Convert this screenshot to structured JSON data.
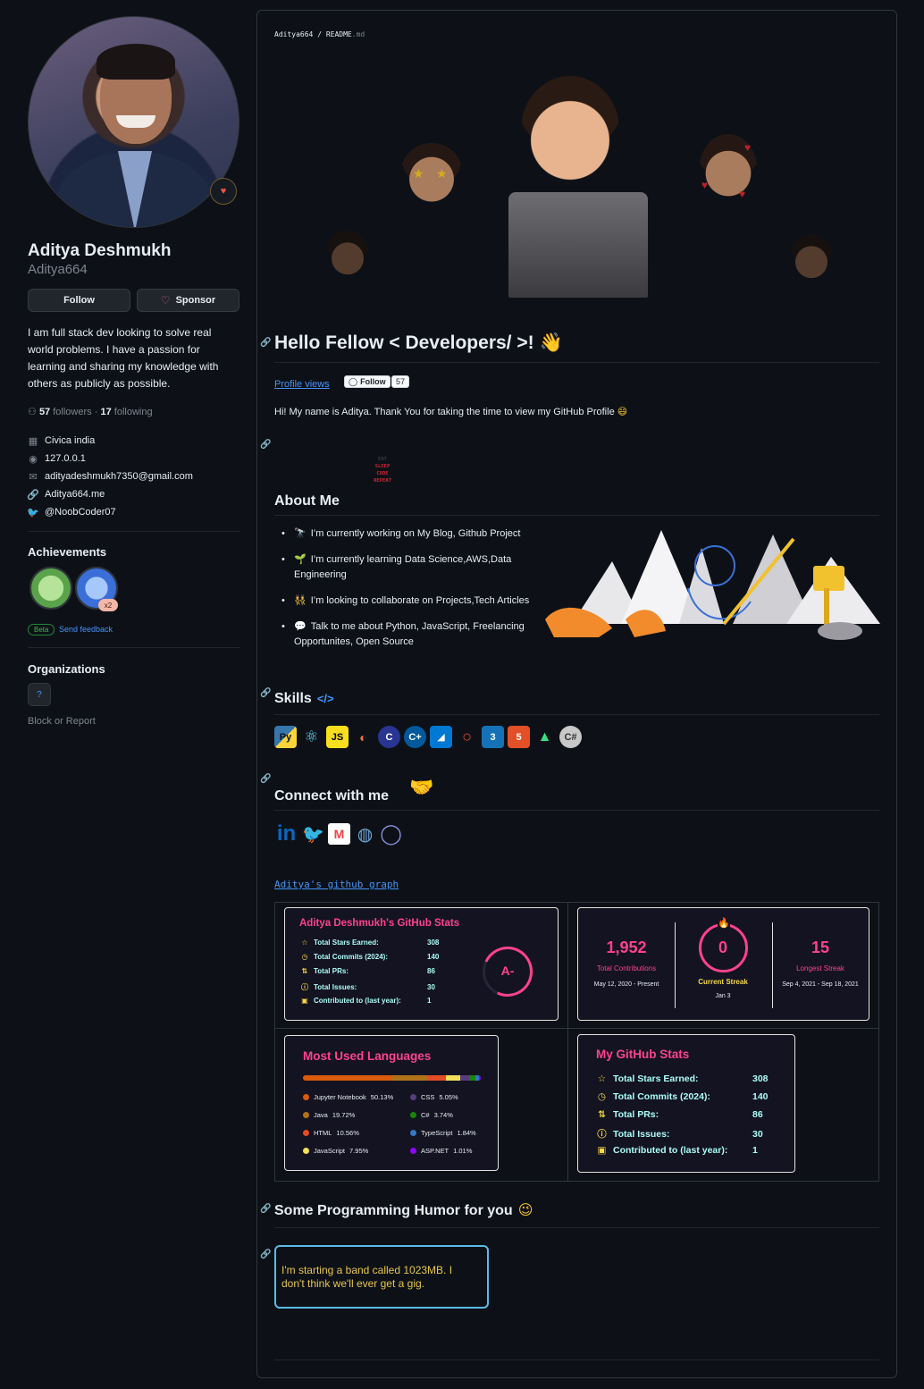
{
  "profile": {
    "name": "Aditya Deshmukh",
    "login": "Aditya664",
    "follow_label": "Follow",
    "sponsor_label": "Sponsor",
    "bio": "I am full stack dev looking to solve real world problems. I have a passion for learning and sharing my knowledge with others as publicly as possible.",
    "followers_count": "57",
    "followers_label": "followers",
    "following_count": "17",
    "following_label": "following",
    "separator": "·",
    "company": "Civica india",
    "location": "127.0.0.1",
    "email": "adityadeshmukh7350@gmail.com",
    "website": "Aditya664.me",
    "twitter": "@NoobCoder07"
  },
  "achievements": {
    "title": "Achievements",
    "multiplier": "x2",
    "beta_label": "Beta",
    "feedback_label": "Send feedback"
  },
  "organizations": {
    "title": "Organizations"
  },
  "block_report": "Block or Report",
  "readme": {
    "owner": "Aditya664",
    "sep": "/",
    "file": "README",
    "ext": ".md",
    "hello_title": "Hello Fellow < Developers/ >!",
    "hello_emoji": "👋",
    "profile_views_alt": "Profile views",
    "follow_badge": "Follow",
    "follow_badge_count": "57",
    "intro": "Hi! My name is Aditya. Thank You for taking the time to view my GitHub Profile",
    "intro_emoji": "😄",
    "sleep_code": [
      "EAT",
      "SLEEP",
      "CODE",
      "REPEAT"
    ],
    "about_title": "About Me",
    "about_items": [
      {
        "emoji": "🔭",
        "text": "I’m currently working on My Blog, Github Project"
      },
      {
        "emoji": "🌱",
        "text": "I’m currently learning Data Science,AWS,Data Engineering"
      },
      {
        "emoji": "👯",
        "text": "I’m looking to collaborate on Projects,Tech Articles"
      },
      {
        "emoji": "💬",
        "text": "Talk to me about Python, JavaScript, Freelancing Opportunites, Open Source"
      }
    ],
    "skills_title": "Skills",
    "skills_code_icon": "</>",
    "skills": [
      "python-icon",
      "react-icon",
      "javascript-icon",
      "swift-icon",
      "c-icon",
      "cplusplus-icon",
      "azure-icon",
      "pytorch-icon",
      "css3-icon",
      "html5-icon",
      "android-icon",
      "csharp-icon"
    ],
    "connect_title": "Connect with me",
    "connect_emoji": "🤝",
    "socials": [
      "linkedin-icon",
      "twitter-icon",
      "medium-icon",
      "website-icon",
      "github-icon"
    ],
    "graph_alt": "Aditya's github graph",
    "humor_title": "Some Programming Humor for you",
    "humor_emoji": "😉",
    "joke": "I'm starting a band called 1023MB. I don't think we'll ever get a gig."
  },
  "stats_card": {
    "title": "Aditya Deshmukh's GitHub Stats",
    "rows": [
      {
        "icon": "☆",
        "label": "Total Stars Earned:",
        "value": "308"
      },
      {
        "icon": "◷",
        "label": "Total Commits (2024):",
        "value": "140"
      },
      {
        "icon": "⇅",
        "label": "Total PRs:",
        "value": "86"
      },
      {
        "icon": "ⓘ",
        "label": "Total Issues:",
        "value": "30"
      },
      {
        "icon": "▣",
        "label": "Contributed to (last year):",
        "value": "1"
      }
    ],
    "grade": "A-"
  },
  "streak_card": {
    "total": "1,952",
    "total_label": "Total Contributions",
    "total_range": "May 12, 2020 - Present",
    "current": "0",
    "current_label": "Current Streak",
    "current_date": "Jan 3",
    "longest": "15",
    "longest_label": "Longest Streak",
    "longest_range": "Sep 4, 2021 - Sep 18, 2021"
  },
  "langs_card": {
    "title": "Most Used Languages",
    "langs": [
      {
        "name": "Jupyter Notebook",
        "pct": "50.13%",
        "value": 50.13,
        "color": "#DA5B0B"
      },
      {
        "name": "Java",
        "pct": "19.72%",
        "value": 19.72,
        "color": "#b07219"
      },
      {
        "name": "HTML",
        "pct": "10.56%",
        "value": 10.56,
        "color": "#e34c26"
      },
      {
        "name": "JavaScript",
        "pct": "7.95%",
        "value": 7.95,
        "color": "#f1e05a"
      },
      {
        "name": "CSS",
        "pct": "5.05%",
        "value": 5.05,
        "color": "#563d7c"
      },
      {
        "name": "C#",
        "pct": "3.74%",
        "value": 3.74,
        "color": "#178600"
      },
      {
        "name": "TypeScript",
        "pct": "1.84%",
        "value": 1.84,
        "color": "#3178c6"
      },
      {
        "name": "ASP.NET",
        "pct": "1.01%",
        "value": 1.01,
        "color": "#9400ff"
      }
    ]
  },
  "stats_card_2": {
    "title": "My GitHub Stats",
    "rows": [
      {
        "icon": "☆",
        "label": "Total Stars Earned:",
        "value": "308"
      },
      {
        "icon": "◷",
        "label": "Total Commits (2024):",
        "value": "140"
      },
      {
        "icon": "⇅",
        "label": "Total PRs:",
        "value": "86"
      },
      {
        "icon": "ⓘ",
        "label": "Total Issues:",
        "value": "30"
      },
      {
        "icon": "▣",
        "label": "Contributed to (last year):",
        "value": "1"
      }
    ]
  },
  "colors": {
    "background": "#0d1117",
    "accent_pink": "#fe428e",
    "stat_text": "#a9fef7",
    "stat_icon": "#f8d847",
    "link": "#4493f8",
    "joke_text": "#e7c54a",
    "joke_border": "#5bbbe6"
  }
}
